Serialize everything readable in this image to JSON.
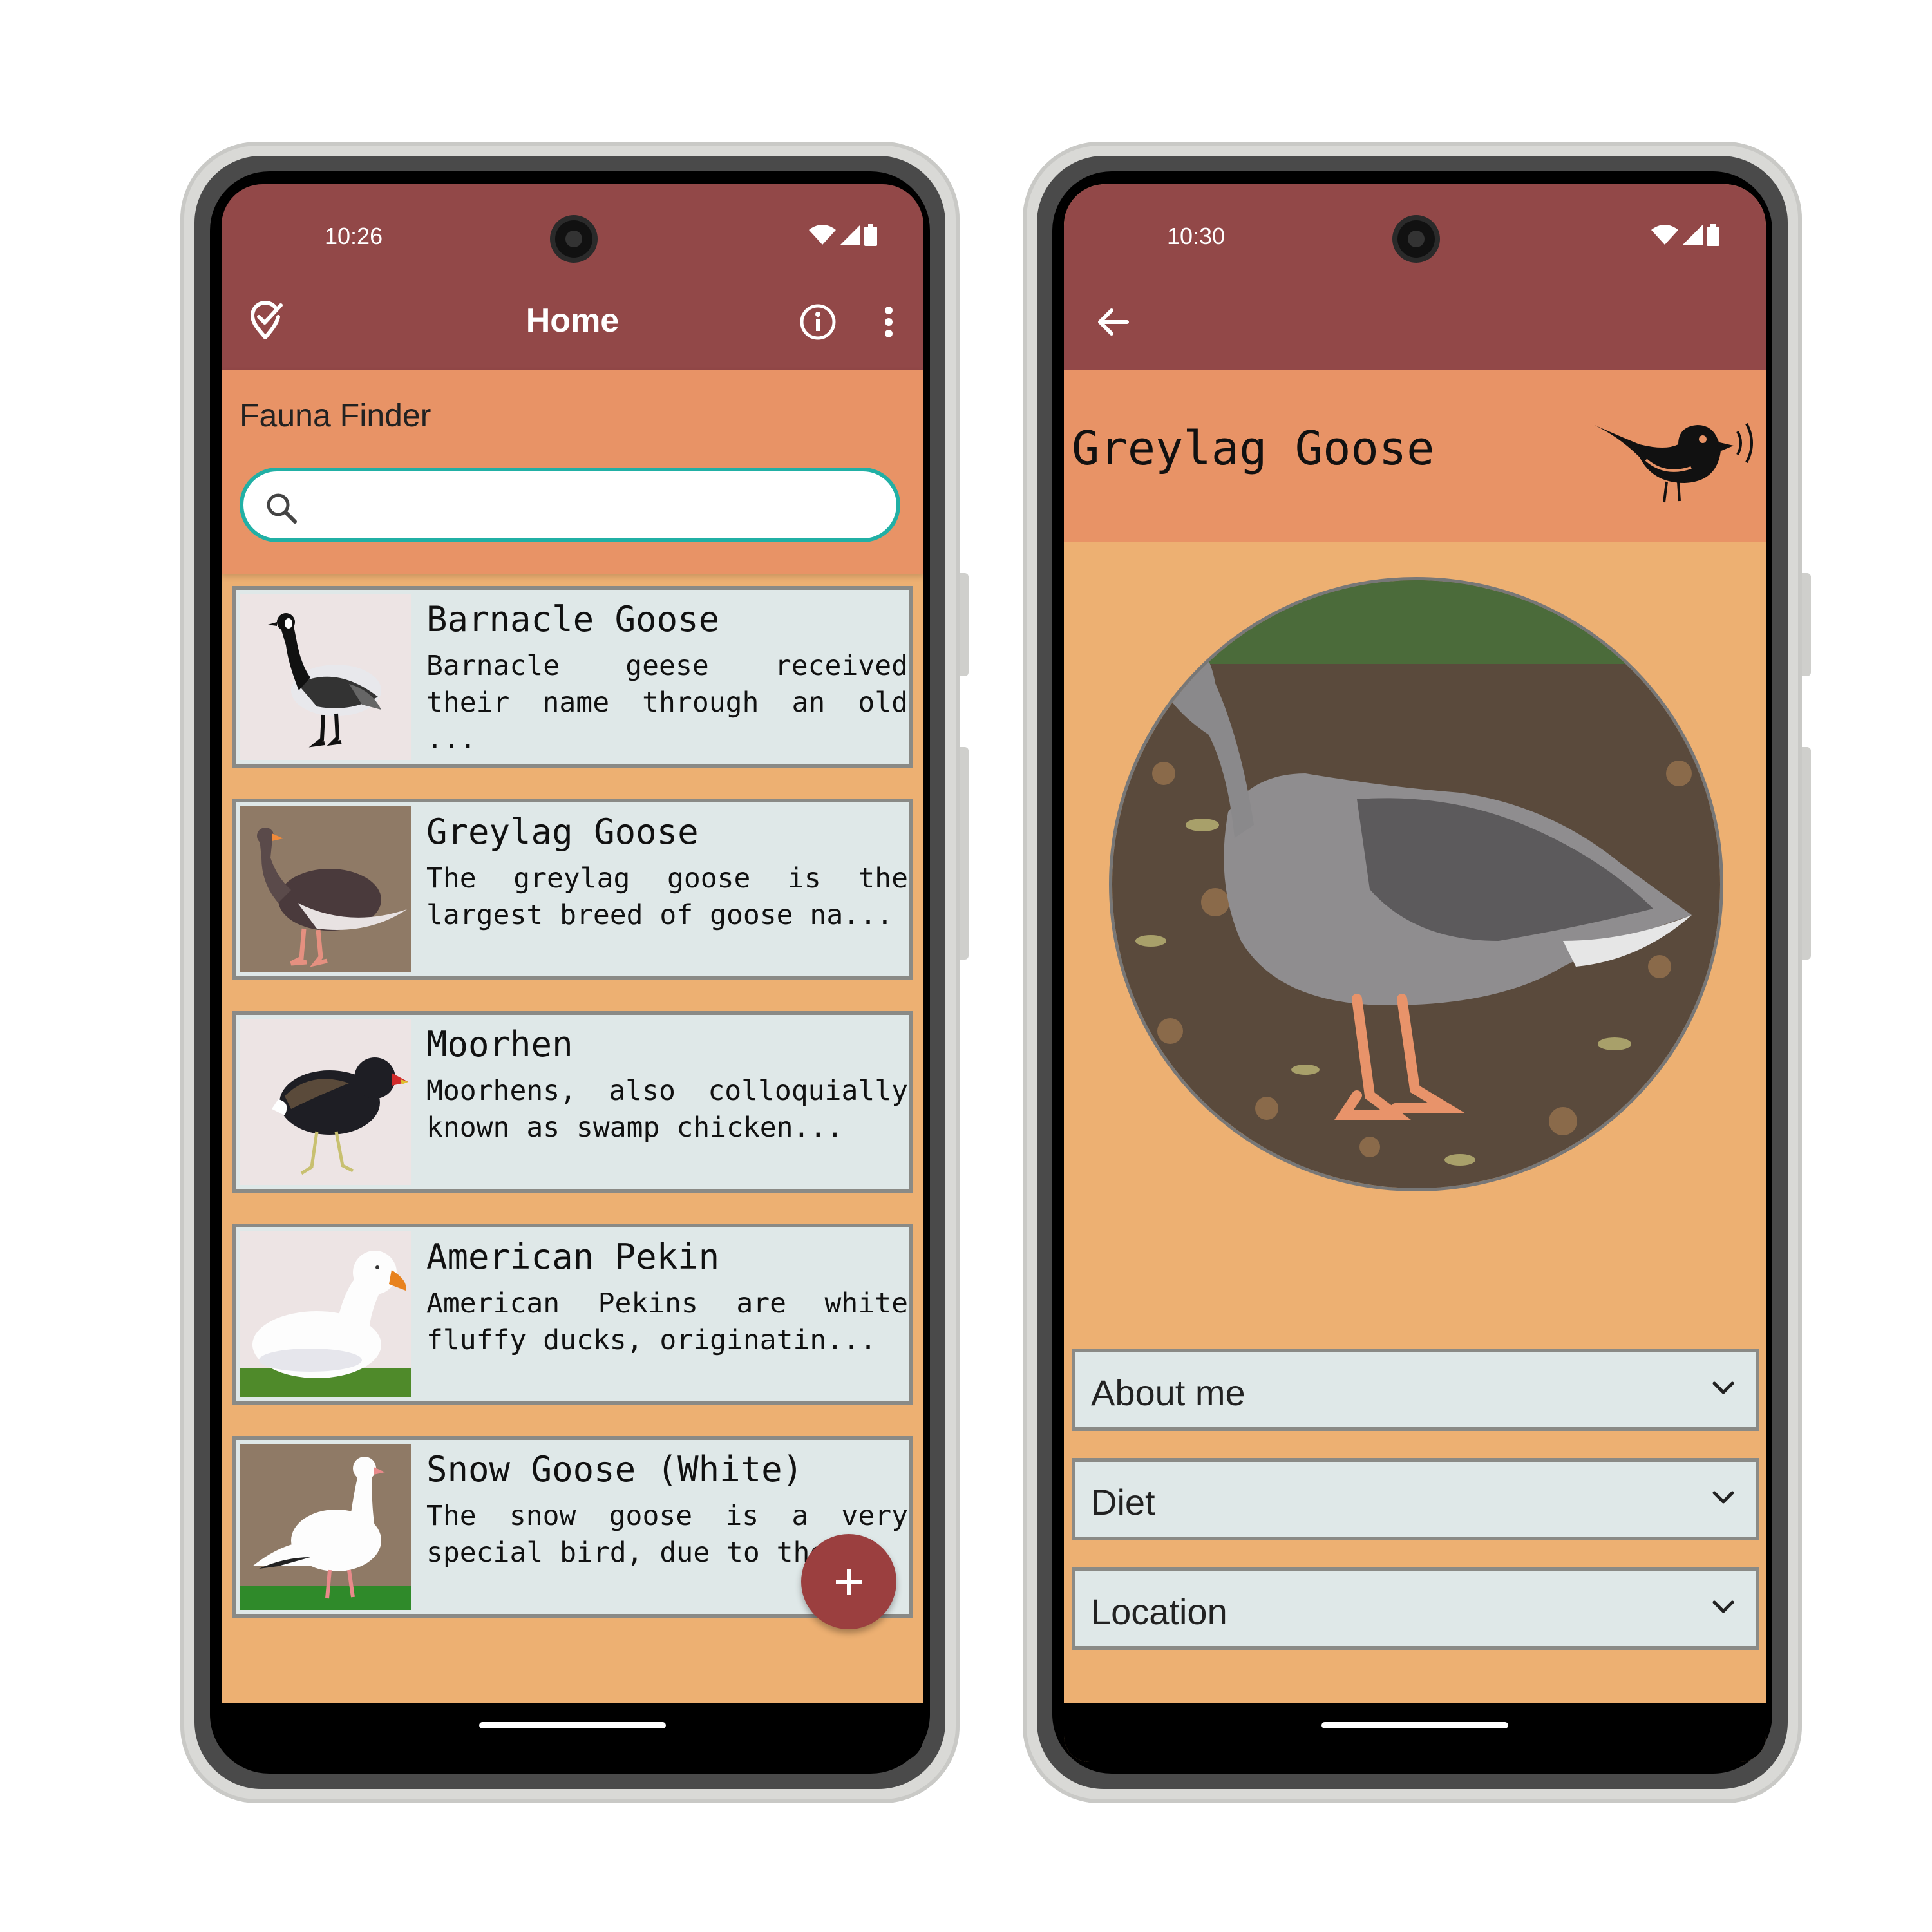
{
  "home_screen": {
    "status": {
      "time": "10:26"
    },
    "appbar": {
      "title": "Home",
      "left_icon": "location-check-icon",
      "info_icon": "info-icon",
      "menu_icon": "more-vert-icon"
    },
    "header": {
      "title": "Fauna Finder"
    },
    "search": {
      "placeholder": "",
      "value": ""
    },
    "animals": [
      {
        "name": "Barnacle Goose",
        "description": "Barnacle geese received their name through an old ..."
      },
      {
        "name": "Greylag Goose",
        "description": "The greylag goose is the largest breed of goose na..."
      },
      {
        "name": "Moorhen",
        "description": "Moorhens, also colloquially known as swamp chicken..."
      },
      {
        "name": "American Pekin",
        "description": "American Pekins are white fluffy ducks, originatin..."
      },
      {
        "name": "Snow Goose (White)",
        "description": "The snow goose is a very special bird, due to the ..."
      }
    ],
    "fab": {
      "label": "+",
      "icon": "add-icon"
    }
  },
  "detail_screen": {
    "status": {
      "time": "10:30"
    },
    "appbar": {
      "back_icon": "arrow-back-icon"
    },
    "animal_name": "Greylag Goose",
    "logo_icon": "singing-bird-icon",
    "sections": [
      "About me",
      "Diet",
      "Location"
    ]
  },
  "colors": {
    "appbar": "#924848",
    "header": "#e89366",
    "background": "#edb072",
    "card": "#dfe8e8",
    "search_border": "#21b0a5",
    "fab": "#9b3f3f"
  }
}
